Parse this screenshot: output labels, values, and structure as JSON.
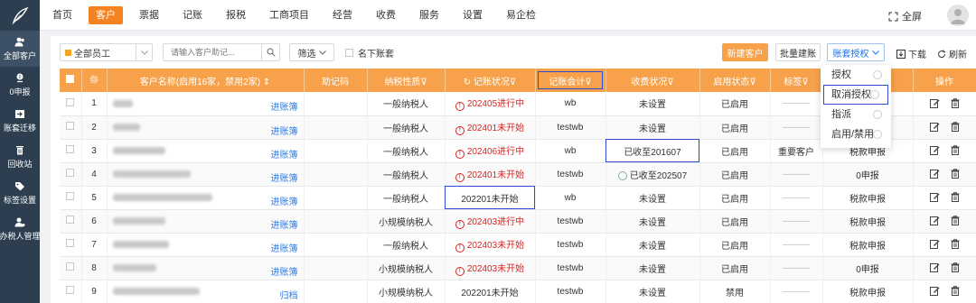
{
  "topnav": {
    "items": [
      "首页",
      "客户",
      "票据",
      "记账",
      "报税",
      "工商项目",
      "经营",
      "收费",
      "服务",
      "设置",
      "易企检"
    ],
    "active_index": 1,
    "fullscreen_label": "全屏"
  },
  "sidebar": {
    "items": [
      {
        "label": "全部客户",
        "icon": "users-icon",
        "active": true
      },
      {
        "label": "0申报",
        "icon": "zero-declare-icon",
        "active": false
      },
      {
        "label": "账套迁移",
        "icon": "migrate-icon",
        "active": false
      },
      {
        "label": "回收站",
        "icon": "trash-icon",
        "active": false
      },
      {
        "label": "标签设置",
        "icon": "tag-icon",
        "active": false
      },
      {
        "label": "办税人管理",
        "icon": "tax-person-icon",
        "active": false
      }
    ]
  },
  "toolbar": {
    "staff_select": "全部员工",
    "search_placeholder": "请输入客户助记...",
    "filter_label": "筛选",
    "my_accounts_label": "名下账套",
    "new_customer": "新建客户",
    "batch_create": "批量建账",
    "account_auth": "账套授权",
    "download": "下载",
    "refresh": "刷新"
  },
  "table": {
    "headers": {
      "name": "客户名称(启用16家，禁用2家)",
      "mnemonic": "助记码",
      "taxpayer_type": "纳税性质",
      "bookkeeping_status": "记账状况",
      "accountant": "记账会计",
      "fee_status": "收费状况",
      "enabled_status": "启用状态",
      "tags": "标签",
      "declare_type": "申报类型",
      "actions": "操作"
    },
    "rows": [
      {
        "idx": "1",
        "action": "进账簿",
        "taxpayer": "一般纳税人",
        "status": "202405进行中",
        "status_red": true,
        "accountant": "wb",
        "fee": "未设置",
        "enabled": "已启用",
        "tags": "",
        "declare": "税款申报"
      },
      {
        "idx": "2",
        "action": "进账簿",
        "taxpayer": "一般纳税人",
        "status": "202401未开始",
        "status_red": true,
        "accountant": "testwb",
        "fee": "未设置",
        "enabled": "已启用",
        "tags": "",
        "declare": "税款申报"
      },
      {
        "idx": "3",
        "action": "进账簿",
        "taxpayer": "一般纳税人",
        "status": "202406进行中",
        "status_red": true,
        "accountant": "wb",
        "fee": "已收至201607",
        "enabled": "已启用",
        "tags": "重要客户",
        "declare": "税款申报"
      },
      {
        "idx": "4",
        "action": "进账簿",
        "taxpayer": "一般纳税人",
        "status": "202401未开始",
        "status_red": true,
        "accountant": "testwb",
        "fee": "已收至202507",
        "enabled": "已启用",
        "tags": "",
        "declare": "0申报"
      },
      {
        "idx": "5",
        "action": "进账簿",
        "taxpayer": "一般纳税人",
        "status": "202201未开始",
        "status_red": false,
        "accountant": "wb",
        "fee": "未设置",
        "enabled": "已启用",
        "tags": "",
        "declare": "税款申报"
      },
      {
        "idx": "6",
        "action": "进账簿",
        "taxpayer": "小规模纳税人",
        "status": "202403进行中",
        "status_red": true,
        "accountant": "testwb",
        "fee": "未设置",
        "enabled": "已启用",
        "tags": "",
        "declare": "税款申报"
      },
      {
        "idx": "7",
        "action": "进账簿",
        "taxpayer": "一般纳税人",
        "status": "202403未开始",
        "status_red": true,
        "accountant": "testwb",
        "fee": "未设置",
        "enabled": "已启用",
        "tags": "",
        "declare": "税款申报"
      },
      {
        "idx": "8",
        "action": "进账簿",
        "taxpayer": "小规模纳税人",
        "status": "202403未开始",
        "status_red": true,
        "accountant": "testwb",
        "fee": "未设置",
        "enabled": "已启用",
        "tags": "",
        "declare": "0申报"
      },
      {
        "idx": "9",
        "action": "归档",
        "taxpayer": "小规模纳税人",
        "status": "202201未开始",
        "status_red": false,
        "accountant": "testwb",
        "fee": "未设置",
        "enabled": "禁用",
        "tags": "",
        "declare": "税款申报"
      }
    ]
  },
  "dropdown": {
    "items": [
      "授权",
      "取消授权",
      "指派",
      "启用/禁用"
    ]
  },
  "colors": {
    "brand_orange": "#f7a24a",
    "sidebar_bg": "#2c3e50",
    "red": "#e02020",
    "link_blue": "#2d7be0",
    "highlight_box": "#2e4ad4"
  }
}
